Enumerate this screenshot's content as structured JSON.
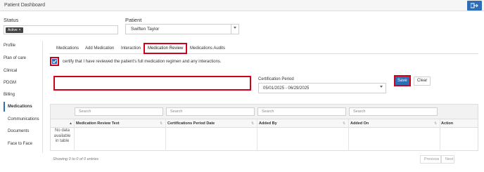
{
  "app": {
    "title": "Patient Dashboard",
    "logout_icon": "logout-icon"
  },
  "status": {
    "label": "Status",
    "chip": "Active",
    "chip_remove": "×"
  },
  "patient": {
    "label": "Patient",
    "value": "Swiften Taylor"
  },
  "sidebar": {
    "items": [
      {
        "label": "Profile"
      },
      {
        "label": "Plan of care"
      },
      {
        "label": "Clinical"
      },
      {
        "label": "PDGM"
      },
      {
        "label": "Billing"
      },
      {
        "label": "Medications",
        "active": true
      },
      {
        "label": "Communications"
      },
      {
        "label": "Documents"
      },
      {
        "label": "Face to Face"
      }
    ]
  },
  "tabs": [
    {
      "label": "Medications"
    },
    {
      "label": "Add Medication"
    },
    {
      "label": "Interaction"
    },
    {
      "label": "Medication Review",
      "active": true
    },
    {
      "label": "Medications Audits"
    }
  ],
  "certify": {
    "checked": true,
    "text": "certify that I have reviewed the patient's full medication regimen and any interactions."
  },
  "review_input": {
    "value": ""
  },
  "certification_period": {
    "label": "Certification Period",
    "value": "05/01/2025 - 06/29/2025"
  },
  "buttons": {
    "save": "Save",
    "clear": "Clear"
  },
  "table": {
    "search_placeholder": "Search",
    "columns": [
      {
        "label": ""
      },
      {
        "label": "Medication Review Text"
      },
      {
        "label": "Certifications Period Date"
      },
      {
        "label": "Added By"
      },
      {
        "label": "Added On"
      },
      {
        "label": "Action"
      }
    ],
    "empty_lines": [
      "No data",
      "available",
      "in table"
    ],
    "info": "Showing 0 to 0 of 0 entries",
    "previous": "Previous",
    "next": "Next"
  },
  "colors": {
    "accent": "#2f6db5",
    "highlight": "#d0021b"
  }
}
